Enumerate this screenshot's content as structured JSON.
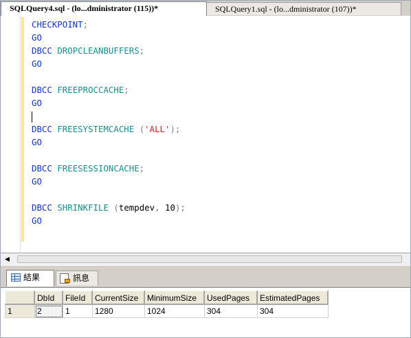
{
  "tabs": [
    {
      "label": "SQLQuery4.sql - (lo...dministrator (115))*",
      "active": true
    },
    {
      "label": "SQLQuery1.sql - (lo...dministrator (107))*",
      "active": false
    }
  ],
  "code_lines": {
    "l1": {
      "kw": "CHECKPOINT",
      "pn": ";"
    },
    "l2": {
      "kw": "GO"
    },
    "l3": {
      "kw": "DBCC",
      "fn": "DROPCLEANBUFFERS",
      "pn": ";"
    },
    "l4": {
      "kw": "GO"
    },
    "l6": {
      "kw": "DBCC",
      "fn": "FREEPROCCACHE",
      "pn": ";"
    },
    "l7": {
      "kw": "GO"
    },
    "l9": {
      "kw": "DBCC",
      "fn": "FREESYSTEMCACHE",
      "open": "(",
      "str": "'ALL'",
      "close": ");"
    },
    "l10": {
      "kw": "GO"
    },
    "l12": {
      "kw": "DBCC",
      "fn": "FREESESSIONCACHE",
      "pn": ";"
    },
    "l13": {
      "kw": "GO"
    },
    "l15": {
      "kw": "DBCC",
      "fn": "SHRINKFILE",
      "open": "(",
      "arg1": "tempdev",
      "comma": ",",
      "arg2": "10",
      "close": ");"
    },
    "l16": {
      "kw": "GO"
    }
  },
  "result_tabs": {
    "results": "結果",
    "messages": "訊息"
  },
  "grid": {
    "columns": [
      "DbId",
      "FileId",
      "CurrentSize",
      "MinimumSize",
      "UsedPages",
      "EstimatedPages"
    ],
    "rows": [
      {
        "rownum": "1",
        "cells": [
          "2",
          "1",
          "1280",
          "1024",
          "304",
          "304"
        ]
      }
    ]
  },
  "icons": [
    "results-grid-icon",
    "messages-icon",
    "scroll-left-arrow-icon"
  ]
}
